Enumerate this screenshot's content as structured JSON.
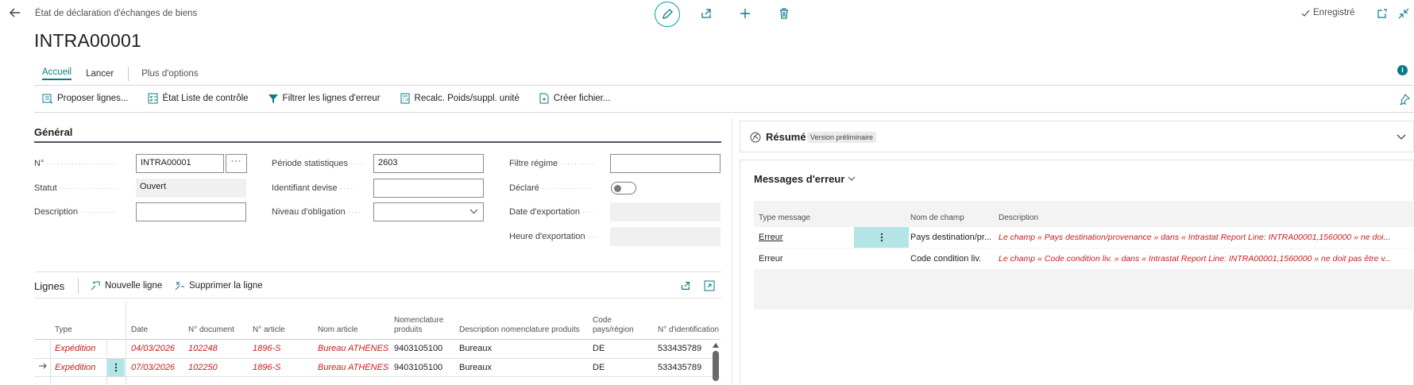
{
  "header": {
    "breadcrumb": "État de déclaration d'échanges de biens",
    "title": "INTRA00001",
    "saved_label": "Enregistré"
  },
  "tabs": [
    {
      "label": "Accueil"
    },
    {
      "label": "Lancer"
    },
    {
      "label": "Plus d'options"
    }
  ],
  "actions": [
    {
      "label": "Proposer lignes...",
      "icon": "suggest-lines-icon"
    },
    {
      "label": "État Liste de contrôle",
      "icon": "checklist-icon"
    },
    {
      "label": "Filtrer les lignes d'erreur",
      "icon": "filter-icon"
    },
    {
      "label": "Recalc. Poids/suppl. unité",
      "icon": "calculator-icon"
    },
    {
      "label": "Créer fichier...",
      "icon": "create-file-icon"
    }
  ],
  "general": {
    "title": "Général",
    "no_label": "N°",
    "no_value": "INTRA00001",
    "status_label": "Statut",
    "status_value": "Ouvert",
    "description_label": "Description",
    "description_value": "",
    "period_label": "Période statistiques",
    "period_value": "2603",
    "currency_label": "Identifiant devise",
    "currency_value": "",
    "obligation_label": "Niveau d'obligation",
    "obligation_value": "",
    "regime_label": "Filtre régime",
    "regime_value": "",
    "declared_label": "Déclaré",
    "declared_value": false,
    "export_date_label": "Date d'exportation",
    "export_time_label": "Heure d'exportation"
  },
  "lines": {
    "title": "Lignes",
    "new_line_label": "Nouvelle ligne",
    "delete_line_label": "Supprimer la ligne",
    "columns": [
      "Type",
      "Date",
      "N° document",
      "N° article",
      "Nom article",
      "Nomenclature produits",
      "Description nomenclature produits",
      "Code pays/région",
      "N° d'identification"
    ],
    "rows": [
      {
        "type": "Expédition",
        "date": "04/03/2026",
        "doc": "102248",
        "item": "1896-S",
        "name": "Bureau ATHÈNES",
        "tariff": "9403105100",
        "tariff_desc": "Bureaux",
        "country": "DE",
        "vat": "533435789"
      },
      {
        "type": "Expédition",
        "date": "07/03/2026",
        "doc": "102250",
        "item": "1896-S",
        "name": "Bureau ATHÈNES",
        "tariff": "9403105100",
        "tariff_desc": "Bureaux",
        "country": "DE",
        "vat": "533435789"
      }
    ]
  },
  "summary": {
    "title": "Résumé",
    "badge": "Version préliminaire"
  },
  "errors": {
    "title": "Messages d'erreur",
    "columns": [
      "Type message",
      "Nom de champ",
      "Description"
    ],
    "rows": [
      {
        "type": "Erreur",
        "field": "Pays destination/pr...",
        "description": "Le champ « Pays destination/provenance » dans « Intrastat Report Line: INTRA00001,1560000 » ne doi..."
      },
      {
        "type": "Erreur",
        "field": "Code condition liv.",
        "description": "Le champ « Code condition liv. » dans « Intrastat Report Line: INTRA00001,1560000 » ne doit pas être v..."
      }
    ]
  },
  "colors": {
    "accent": "#00a1a6",
    "error": "#c41e1e",
    "highlight": "#b3e4e6"
  }
}
